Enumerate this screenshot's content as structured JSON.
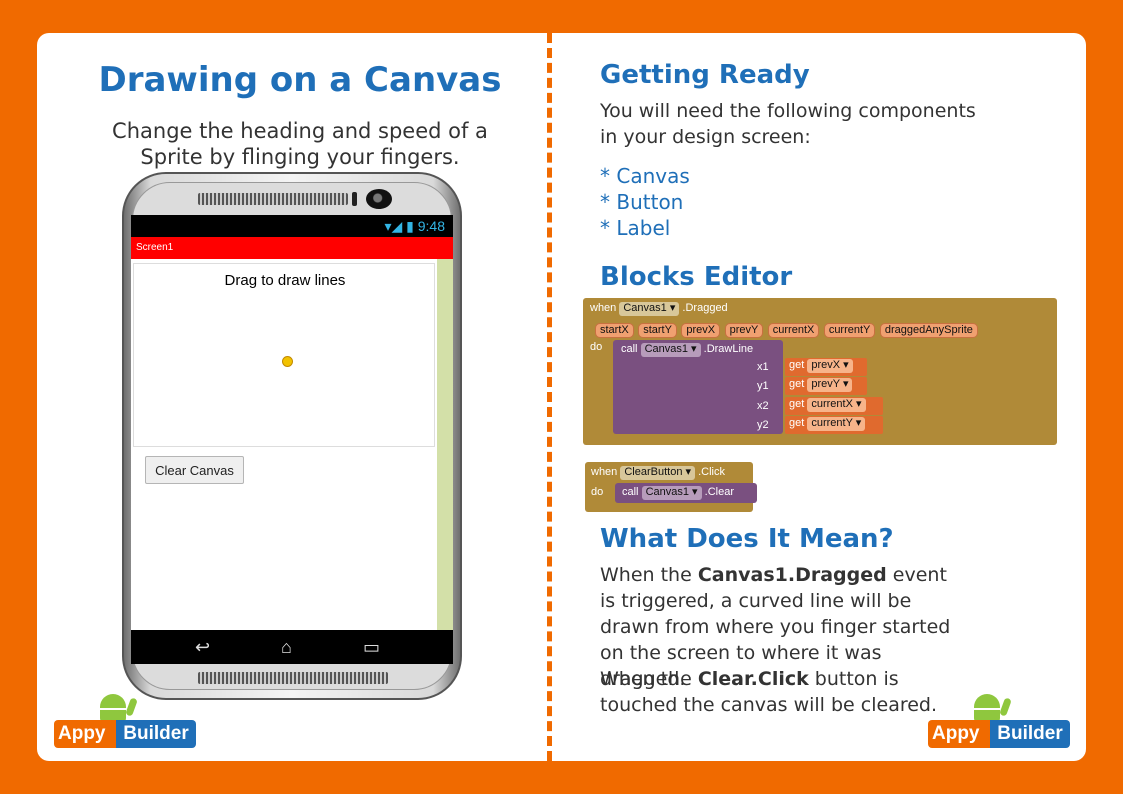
{
  "left": {
    "title": "Drawing on a Canvas",
    "subtitle": "Change the heading and speed of a Sprite by flinging your fingers."
  },
  "phone": {
    "time": "9:48",
    "screen_title": "Screen1",
    "canvas_label": "Drag to draw lines",
    "clear_button": "Clear Canvas",
    "nav_back": "↩",
    "nav_home": "⌂",
    "nav_recent": "▭"
  },
  "logo": {
    "appy": "Appy",
    "builder": "Builder"
  },
  "right": {
    "getting_ready_heading": "Getting Ready",
    "getting_ready_text": "You will need the following components in your design screen:",
    "components": [
      "* Canvas",
      "* Button",
      "* Label"
    ],
    "blocks_heading": "Blocks Editor",
    "meaning_heading": "What Does It Mean?",
    "meaning_p1_a": "When the ",
    "meaning_p1_bold": "Canvas1.Dragged",
    "meaning_p1_b": " event is triggered, a curved line will be drawn from where you finger started on the screen to where it was dragged.",
    "meaning_p2_a": "When the ",
    "meaning_p2_bold": "Clear.Click",
    "meaning_p2_b": " button is touched the canvas will be cleared."
  },
  "blocks": {
    "when": "when",
    "do": "do",
    "call": "call",
    "get": "get",
    "event1_component": "Canvas1",
    "event1_name": ".Dragged",
    "params": [
      "startX",
      "startY",
      "prevX",
      "prevY",
      "currentX",
      "currentY",
      "draggedAnySprite"
    ],
    "call1_component": "Canvas1",
    "call1_method": ".DrawLine",
    "args": [
      {
        "name": "x1",
        "var": "prevX"
      },
      {
        "name": "y1",
        "var": "prevY"
      },
      {
        "name": "x2",
        "var": "currentX"
      },
      {
        "name": "y2",
        "var": "currentY"
      }
    ],
    "event2_component": "ClearButton",
    "event2_name": ".Click",
    "call2_component": "Canvas1",
    "call2_method": ".Clear"
  },
  "colors": {
    "orange": "#f06a00",
    "blue": "#1f6fb8",
    "event_block": "#b08a38",
    "call_block": "#7a5080",
    "get_block": "#e06a2e"
  }
}
